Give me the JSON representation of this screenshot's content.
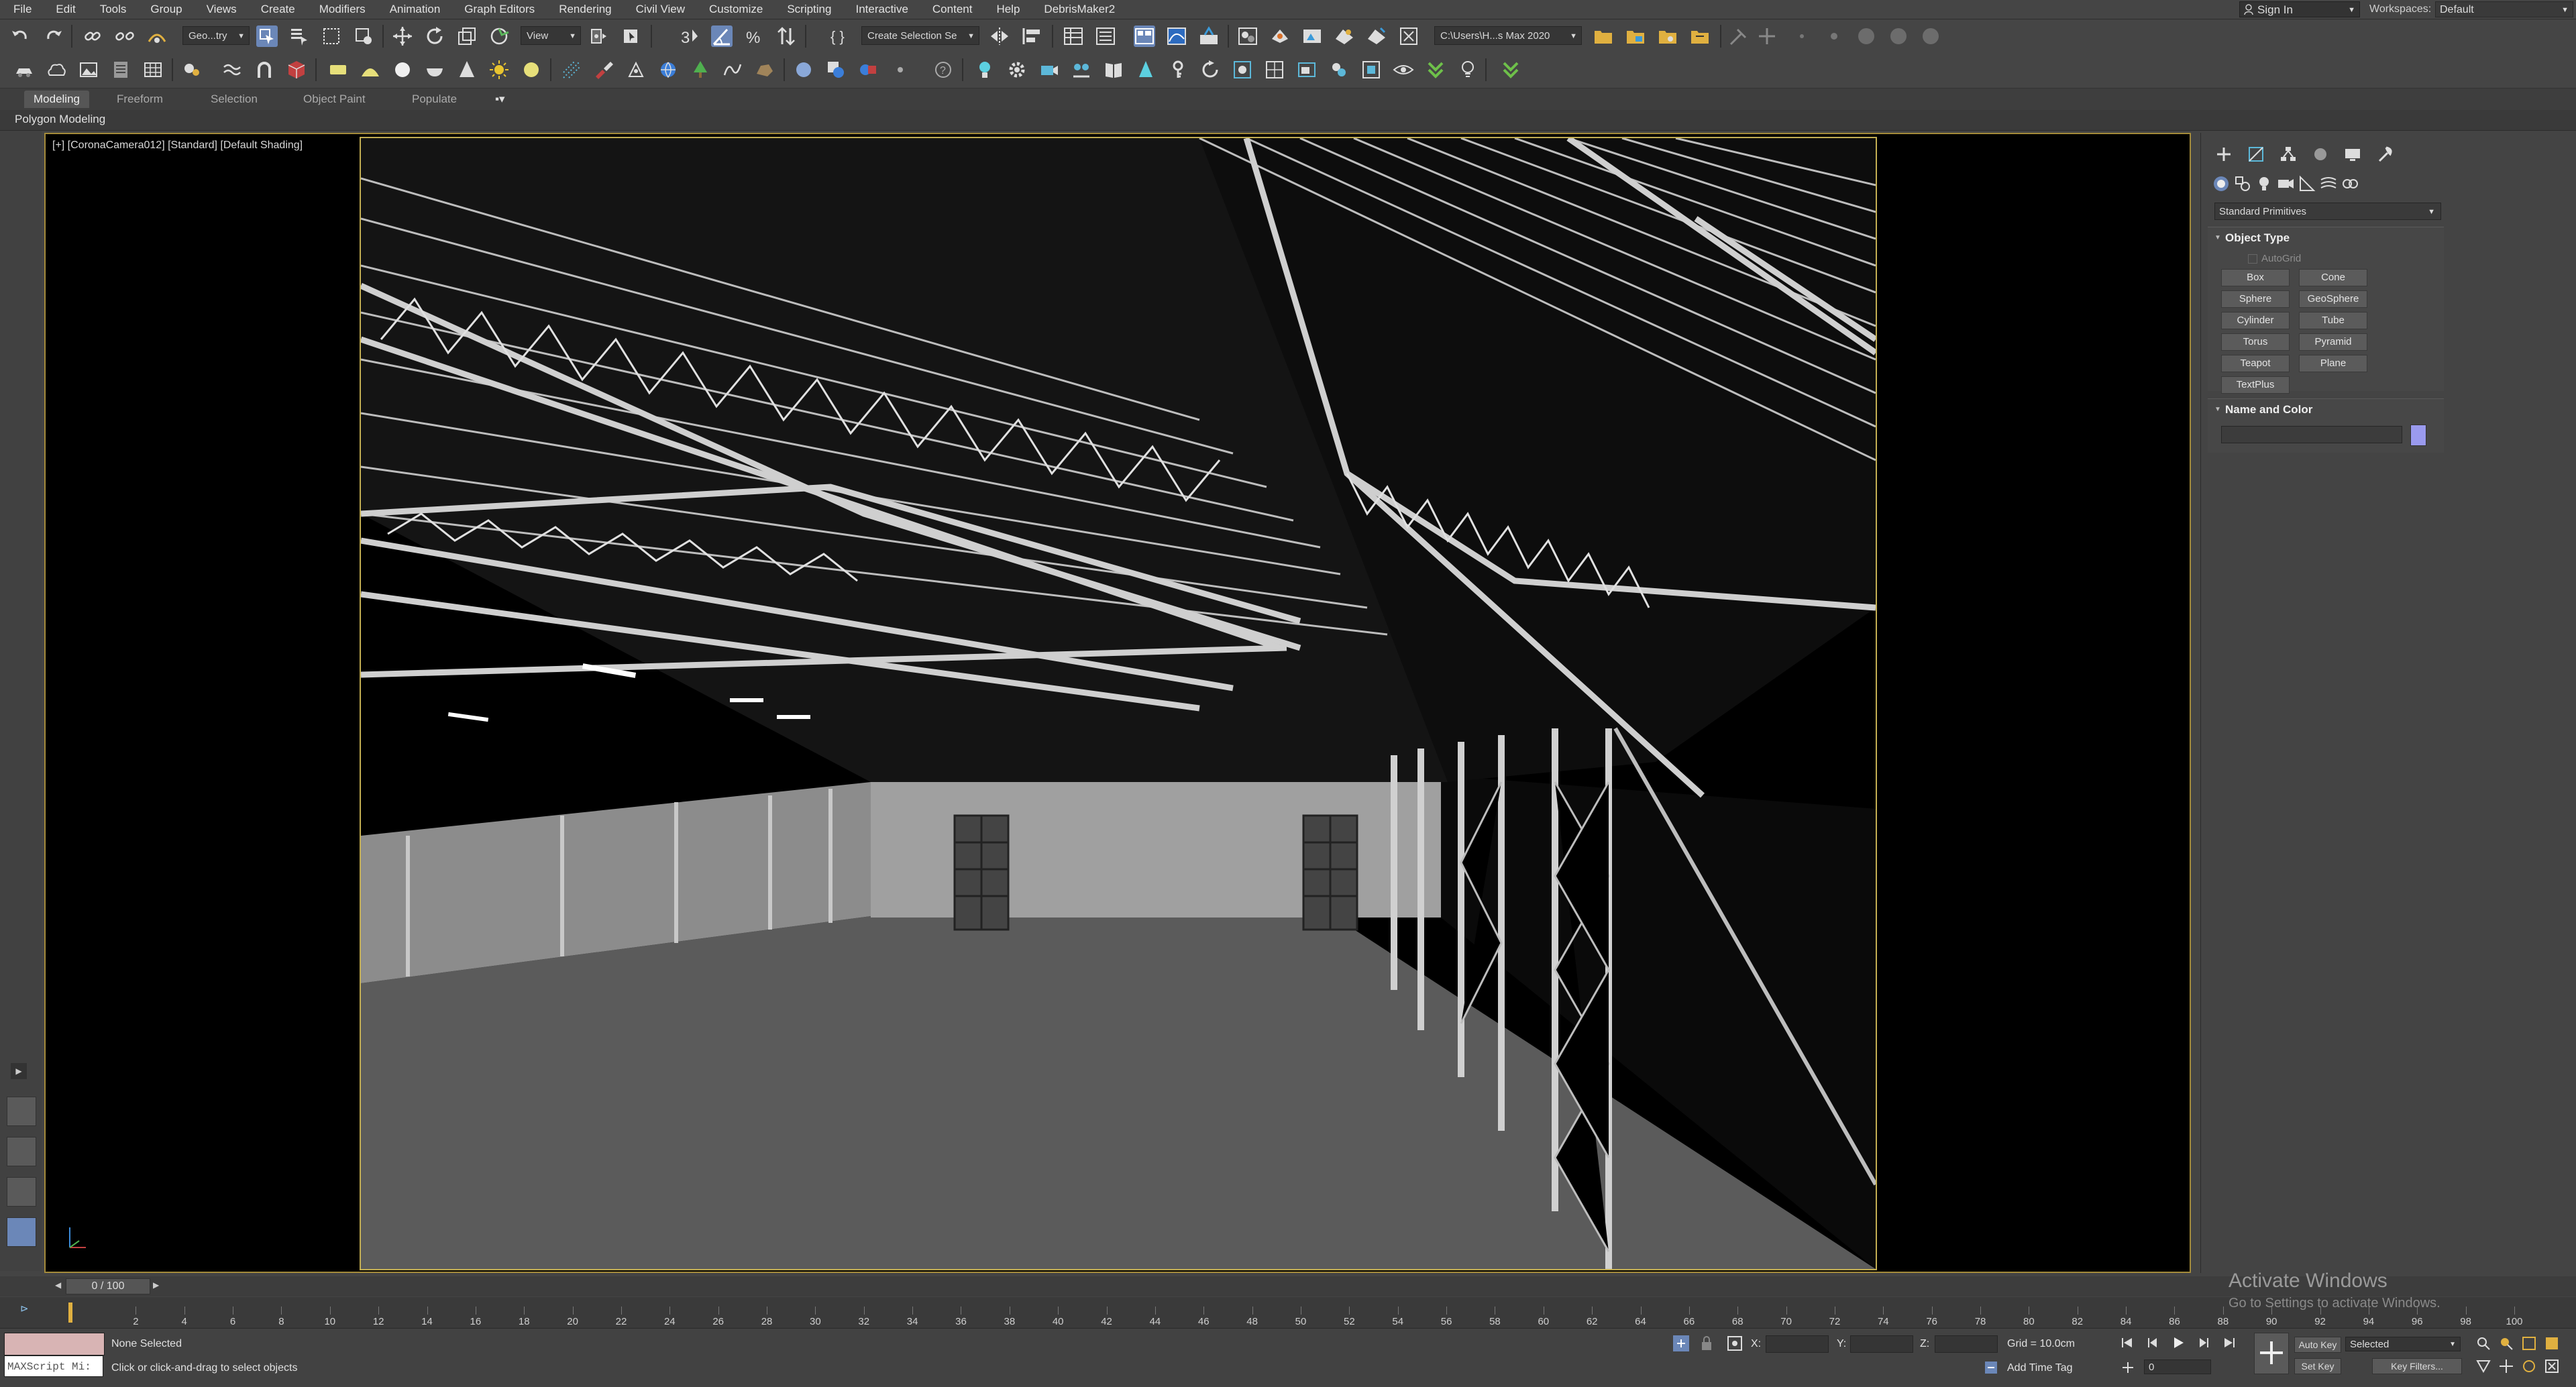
{
  "menu": {
    "items": [
      "File",
      "Edit",
      "Tools",
      "Group",
      "Views",
      "Create",
      "Modifiers",
      "Animation",
      "Graph Editors",
      "Rendering",
      "Civil View",
      "Customize",
      "Scripting",
      "Interactive",
      "Content",
      "Help",
      "DebrisMaker2"
    ],
    "sign_in": "Sign In",
    "workspaces_label": "Workspaces:",
    "workspace_value": "Default"
  },
  "toolbar": {
    "selection_filter": "Geo...try",
    "reference_coord": "View",
    "named_selection": "Create Selection Se",
    "project_path": "C:\\Users\\H...s Max 2020"
  },
  "ribbon": {
    "tabs": [
      "Modeling",
      "Freeform",
      "Selection",
      "Object Paint",
      "Populate"
    ],
    "active_tab": "Modeling",
    "panel_label": "Polygon Modeling"
  },
  "viewport": {
    "label": "[+] [CoronaCamera012] [Standard] [Default Shading]",
    "colors": {
      "border_active": "#c2ad52",
      "background": "#000000"
    }
  },
  "command_panel": {
    "category": "Standard Primitives",
    "object_type": {
      "title": "Object Type",
      "autogrid": "AutoGrid",
      "buttons": [
        "Box",
        "Cone",
        "Sphere",
        "GeoSphere",
        "Cylinder",
        "Tube",
        "Torus",
        "Pyramid",
        "Teapot",
        "Plane",
        "TextPlus"
      ]
    },
    "name_and_color": {
      "title": "Name and Color",
      "name_value": "",
      "color": "#9a9aee"
    }
  },
  "timeline": {
    "frame_display": "0 / 100",
    "ticks": [
      2,
      4,
      6,
      8,
      10,
      12,
      14,
      16,
      18,
      20,
      22,
      24,
      26,
      28,
      30,
      32,
      34,
      36,
      38,
      40,
      42,
      44,
      46,
      48,
      50,
      52,
      54,
      56,
      58,
      60,
      62,
      64,
      66,
      68,
      70,
      72,
      74,
      76,
      78,
      80,
      82,
      84,
      86,
      88,
      90,
      92,
      94,
      96,
      98,
      100
    ]
  },
  "status": {
    "maxscript": "MAXScript Mi:",
    "selection": "None Selected",
    "prompt": "Click or click-and-drag to select objects",
    "x_label": "X:",
    "y_label": "Y:",
    "z_label": "Z:",
    "grid": "Grid = 10.0cm",
    "add_time_tag": "Add Time Tag",
    "auto_key": "Auto Key",
    "auto_key_mode": "Selected",
    "set_key": "Set Key",
    "key_filters": "Key Filters...",
    "current_frame": "0"
  },
  "watermark": {
    "title": "Activate Windows",
    "subtitle": "Go to Settings to activate Windows."
  }
}
